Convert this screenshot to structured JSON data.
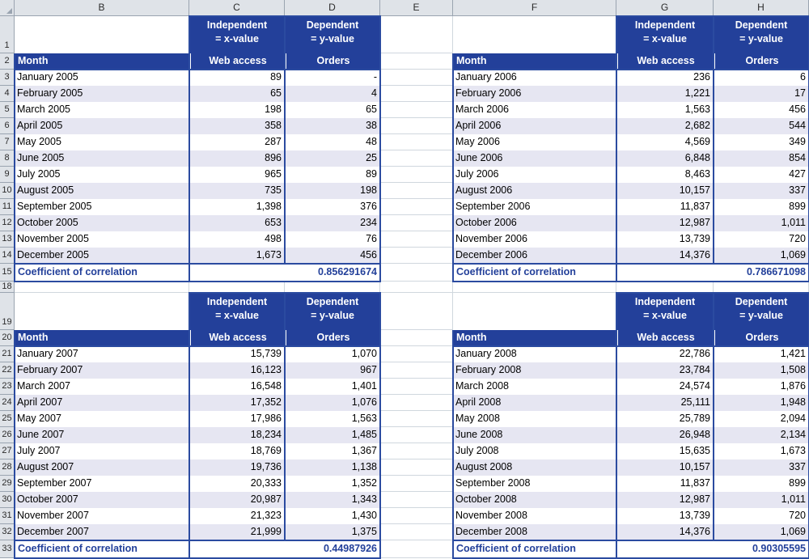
{
  "app": {
    "type": "spreadsheet",
    "colors": {
      "header_navy": "#23409a",
      "border_navy": "#2b4ba0",
      "alt_row": "#e6e6f2",
      "grid_gray": "#d0d7de",
      "headstrip_gray": "#dfe3e8"
    }
  },
  "column_headers": [
    "B",
    "C",
    "D",
    "E",
    "F",
    "G",
    "H"
  ],
  "row_headers": [
    "1",
    "2",
    "3",
    "4",
    "5",
    "6",
    "7",
    "8",
    "9",
    "10",
    "11",
    "12",
    "13",
    "14",
    "15",
    "18",
    "19",
    "20",
    "21",
    "22",
    "23",
    "24",
    "25",
    "26",
    "27",
    "28",
    "29",
    "30",
    "31",
    "32",
    "33"
  ],
  "labels": {
    "independent": "Independent\n= x-value",
    "independent_line1": "Independent",
    "independent_line2": "= x-value",
    "dependent_line1": "Dependent",
    "dependent_line2": "= y-value",
    "month": "Month",
    "web_access": "Web access",
    "orders": "Orders",
    "coefficient": "Coefficient of correlation"
  },
  "tables": [
    {
      "id": "table-2005",
      "position": "top-left",
      "columns": [
        "Month",
        "Web access",
        "Orders"
      ],
      "rows": [
        {
          "month": "January 2005",
          "web": "89",
          "orders": "-"
        },
        {
          "month": "February 2005",
          "web": "65",
          "orders": "4"
        },
        {
          "month": "March 2005",
          "web": "198",
          "orders": "65"
        },
        {
          "month": "April 2005",
          "web": "358",
          "orders": "38"
        },
        {
          "month": "May 2005",
          "web": "287",
          "orders": "48"
        },
        {
          "month": "June 2005",
          "web": "896",
          "orders": "25"
        },
        {
          "month": "July 2005",
          "web": "965",
          "orders": "89"
        },
        {
          "month": "August 2005",
          "web": "735",
          "orders": "198"
        },
        {
          "month": "September 2005",
          "web": "1,398",
          "orders": "376"
        },
        {
          "month": "October 2005",
          "web": "653",
          "orders": "234"
        },
        {
          "month": "November 2005",
          "web": "498",
          "orders": "76"
        },
        {
          "month": "December 2005",
          "web": "1,673",
          "orders": "456"
        }
      ],
      "coefficient_label": "Coefficient of correlation",
      "coefficient_value": "0.856291674"
    },
    {
      "id": "table-2006",
      "position": "top-right",
      "columns": [
        "Month",
        "Web access",
        "Orders"
      ],
      "rows": [
        {
          "month": "January 2006",
          "web": "236",
          "orders": "6"
        },
        {
          "month": "February 2006",
          "web": "1,221",
          "orders": "17"
        },
        {
          "month": "March 2006",
          "web": "1,563",
          "orders": "456"
        },
        {
          "month": "April 2006",
          "web": "2,682",
          "orders": "544"
        },
        {
          "month": "May 2006",
          "web": "4,569",
          "orders": "349"
        },
        {
          "month": "June 2006",
          "web": "6,848",
          "orders": "854"
        },
        {
          "month": "July 2006",
          "web": "8,463",
          "orders": "427"
        },
        {
          "month": "August 2006",
          "web": "10,157",
          "orders": "337"
        },
        {
          "month": "September 2006",
          "web": "11,837",
          "orders": "899"
        },
        {
          "month": "October 2006",
          "web": "12,987",
          "orders": "1,011"
        },
        {
          "month": "November 2006",
          "web": "13,739",
          "orders": "720"
        },
        {
          "month": "December 2006",
          "web": "14,376",
          "orders": "1,069"
        }
      ],
      "coefficient_label": "Coefficient of correlation",
      "coefficient_value": "0.786671098"
    },
    {
      "id": "table-2007",
      "position": "bottom-left",
      "columns": [
        "Month",
        "Web access",
        "Orders"
      ],
      "rows": [
        {
          "month": "January 2007",
          "web": "15,739",
          "orders": "1,070"
        },
        {
          "month": "February 2007",
          "web": "16,123",
          "orders": "967"
        },
        {
          "month": "March 2007",
          "web": "16,548",
          "orders": "1,401"
        },
        {
          "month": "April 2007",
          "web": "17,352",
          "orders": "1,076"
        },
        {
          "month": "May 2007",
          "web": "17,986",
          "orders": "1,563"
        },
        {
          "month": "June 2007",
          "web": "18,234",
          "orders": "1,485"
        },
        {
          "month": "July 2007",
          "web": "18,769",
          "orders": "1,367"
        },
        {
          "month": "August 2007",
          "web": "19,736",
          "orders": "1,138"
        },
        {
          "month": "September 2007",
          "web": "20,333",
          "orders": "1,352"
        },
        {
          "month": "October 2007",
          "web": "20,987",
          "orders": "1,343"
        },
        {
          "month": "November 2007",
          "web": "21,323",
          "orders": "1,430"
        },
        {
          "month": "December 2007",
          "web": "21,999",
          "orders": "1,375"
        }
      ],
      "coefficient_label": "Coefficient of correlation",
      "coefficient_value": "0.44987926"
    },
    {
      "id": "table-2008",
      "position": "bottom-right",
      "columns": [
        "Month",
        "Web access",
        "Orders"
      ],
      "rows": [
        {
          "month": "January 2008",
          "web": "22,786",
          "orders": "1,421"
        },
        {
          "month": "February 2008",
          "web": "23,784",
          "orders": "1,508"
        },
        {
          "month": "March 2008",
          "web": "24,574",
          "orders": "1,876"
        },
        {
          "month": "April 2008",
          "web": "25,111",
          "orders": "1,948"
        },
        {
          "month": "May 2008",
          "web": "25,789",
          "orders": "2,094"
        },
        {
          "month": "June 2008",
          "web": "26,948",
          "orders": "2,134"
        },
        {
          "month": "July 2008",
          "web": "15,635",
          "orders": "1,673"
        },
        {
          "month": "August 2008",
          "web": "10,157",
          "orders": "337"
        },
        {
          "month": "September 2008",
          "web": "11,837",
          "orders": "899"
        },
        {
          "month": "October 2008",
          "web": "12,987",
          "orders": "1,011"
        },
        {
          "month": "November 2008",
          "web": "13,739",
          "orders": "720"
        },
        {
          "month": "December 2008",
          "web": "14,376",
          "orders": "1,069"
        }
      ],
      "coefficient_label": "Coefficient of correlation",
      "coefficient_value": "0.90305595"
    }
  ]
}
